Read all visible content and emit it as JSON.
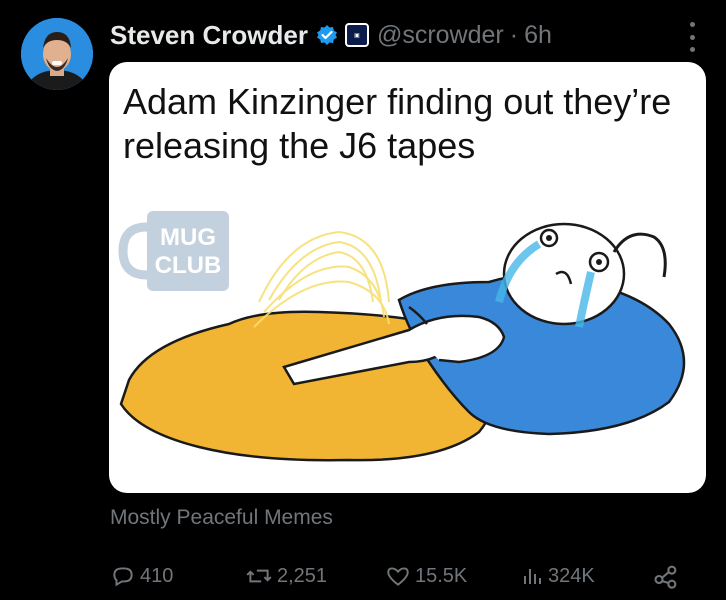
{
  "tweet": {
    "author_name": "Steven Crowder",
    "handle": "@scrowder",
    "separator": "·",
    "time": "6h",
    "media_caption": "Adam Kinzinger finding out they’re releasing the J6 tapes",
    "watermark": "MUG CLUB",
    "source": "Mostly Peaceful Memes"
  },
  "actions": {
    "replies": "410",
    "reposts": "2,251",
    "likes": "15.5K",
    "views": "324K"
  },
  "colors": {
    "background": "#000000",
    "text": "#e7e9ea",
    "muted": "#71767b",
    "verified": "#1d9bf0"
  },
  "icons": [
    "verified-badge-icon",
    "affiliate-badge-icon",
    "more-icon",
    "reply-icon",
    "repost-icon",
    "like-icon",
    "views-icon",
    "share-icon"
  ]
}
